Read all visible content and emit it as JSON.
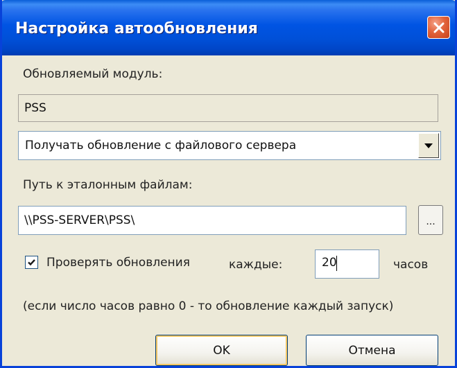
{
  "window": {
    "title": "Настройка автообновления"
  },
  "module": {
    "label": "Обновляемый модуль:",
    "value": "PSS"
  },
  "source": {
    "selected": "Получать обновление с файлового сервера"
  },
  "path": {
    "label": "Путь к эталонным файлам:",
    "value": "\\\\PSS-SERVER\\PSS\\",
    "browse_label": "..."
  },
  "check": {
    "checked": true,
    "label": "Проверять обновления",
    "every_label": "каждые:",
    "hours_value": "20",
    "hours_label": "часов"
  },
  "note": "(если число часов равно 0 - то обновление каждый запуск)",
  "buttons": {
    "ok": "OK",
    "cancel": "Отмена"
  },
  "colors": {
    "titlebar": "#0054e3",
    "close_button": "#e2643c",
    "dialog_background": "#ece9d8"
  }
}
